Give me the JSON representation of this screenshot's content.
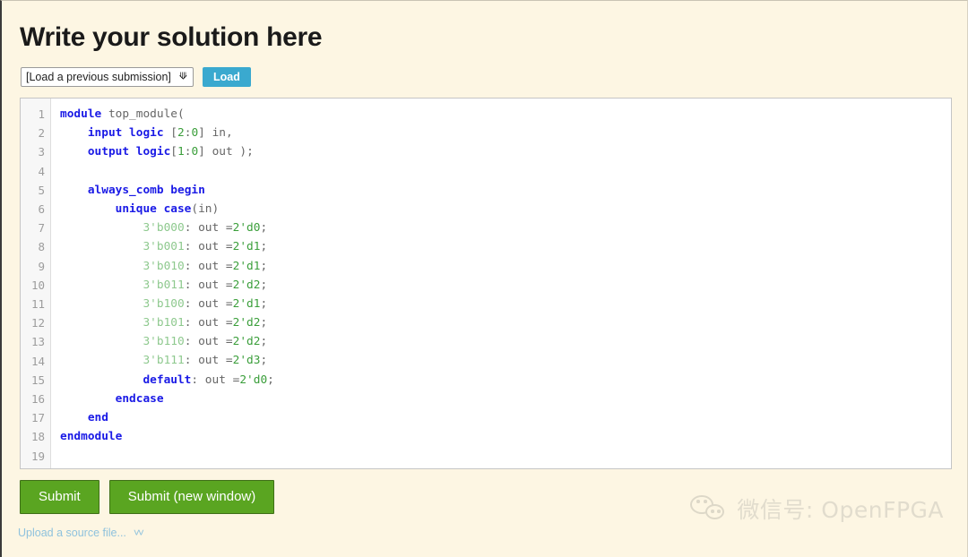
{
  "page": {
    "title": "Write your solution here",
    "background_color": "#fdf6e3"
  },
  "toolbar": {
    "submission_select": {
      "selected": "[Load a previous submission]",
      "options": [
        "[Load a previous submission]"
      ],
      "arrow_icon": "chevron-down-icon"
    },
    "load_label": "Load",
    "load_color": "#3aa9cf"
  },
  "editor": {
    "language": "systemverilog",
    "line_numbers": [
      "1",
      "2",
      "3",
      "4",
      "5",
      "6",
      "7",
      "8",
      "9",
      "10",
      "11",
      "12",
      "13",
      "14",
      "15",
      "16",
      "17",
      "18",
      "19"
    ],
    "lines": [
      {
        "n": "1",
        "tokens": [
          {
            "t": "module",
            "c": "k"
          },
          {
            "t": " top_module(",
            "c": "p"
          }
        ]
      },
      {
        "n": "2",
        "tokens": [
          {
            "t": "    ",
            "c": "p"
          },
          {
            "t": "input logic",
            "c": "k"
          },
          {
            "t": " [",
            "c": "p"
          },
          {
            "t": "2",
            "c": "n"
          },
          {
            "t": ":",
            "c": "p"
          },
          {
            "t": "0",
            "c": "n"
          },
          {
            "t": "] in,",
            "c": "p"
          }
        ]
      },
      {
        "n": "3",
        "tokens": [
          {
            "t": "    ",
            "c": "p"
          },
          {
            "t": "output logic",
            "c": "k"
          },
          {
            "t": "[",
            "c": "p"
          },
          {
            "t": "1",
            "c": "n"
          },
          {
            "t": ":",
            "c": "p"
          },
          {
            "t": "0",
            "c": "n"
          },
          {
            "t": "] out );",
            "c": "p"
          }
        ]
      },
      {
        "n": "4",
        "tokens": [
          {
            "t": "",
            "c": "p"
          }
        ]
      },
      {
        "n": "5",
        "tokens": [
          {
            "t": "    ",
            "c": "p"
          },
          {
            "t": "always_comb begin",
            "c": "k"
          }
        ]
      },
      {
        "n": "6",
        "tokens": [
          {
            "t": "        ",
            "c": "p"
          },
          {
            "t": "unique case",
            "c": "k"
          },
          {
            "t": "(in)",
            "c": "p"
          }
        ]
      },
      {
        "n": "7",
        "tokens": [
          {
            "t": "            ",
            "c": "p"
          },
          {
            "t": "3'b000",
            "c": "nl"
          },
          {
            "t": ": out =",
            "c": "p"
          },
          {
            "t": "2",
            "c": "n"
          },
          {
            "t": "'d0",
            "c": "n"
          },
          {
            "t": ";",
            "c": "p"
          }
        ]
      },
      {
        "n": "8",
        "tokens": [
          {
            "t": "            ",
            "c": "p"
          },
          {
            "t": "3'b001",
            "c": "nl"
          },
          {
            "t": ": out =",
            "c": "p"
          },
          {
            "t": "2",
            "c": "n"
          },
          {
            "t": "'d1",
            "c": "n"
          },
          {
            "t": ";",
            "c": "p"
          }
        ]
      },
      {
        "n": "9",
        "tokens": [
          {
            "t": "            ",
            "c": "p"
          },
          {
            "t": "3'b010",
            "c": "nl"
          },
          {
            "t": ": out =",
            "c": "p"
          },
          {
            "t": "2",
            "c": "n"
          },
          {
            "t": "'d1",
            "c": "n"
          },
          {
            "t": ";",
            "c": "p"
          }
        ]
      },
      {
        "n": "10",
        "tokens": [
          {
            "t": "            ",
            "c": "p"
          },
          {
            "t": "3'b011",
            "c": "nl"
          },
          {
            "t": ": out =",
            "c": "p"
          },
          {
            "t": "2",
            "c": "n"
          },
          {
            "t": "'d2",
            "c": "n"
          },
          {
            "t": ";",
            "c": "p"
          }
        ]
      },
      {
        "n": "11",
        "tokens": [
          {
            "t": "            ",
            "c": "p"
          },
          {
            "t": "3'b100",
            "c": "nl"
          },
          {
            "t": ": out =",
            "c": "p"
          },
          {
            "t": "2",
            "c": "n"
          },
          {
            "t": "'d1",
            "c": "n"
          },
          {
            "t": ";",
            "c": "p"
          }
        ]
      },
      {
        "n": "12",
        "tokens": [
          {
            "t": "            ",
            "c": "p"
          },
          {
            "t": "3'b101",
            "c": "nl"
          },
          {
            "t": ": out =",
            "c": "p"
          },
          {
            "t": "2",
            "c": "n"
          },
          {
            "t": "'d2",
            "c": "n"
          },
          {
            "t": ";",
            "c": "p"
          }
        ]
      },
      {
        "n": "13",
        "tokens": [
          {
            "t": "            ",
            "c": "p"
          },
          {
            "t": "3'b110",
            "c": "nl"
          },
          {
            "t": ": out =",
            "c": "p"
          },
          {
            "t": "2",
            "c": "n"
          },
          {
            "t": "'d2",
            "c": "n"
          },
          {
            "t": ";",
            "c": "p"
          }
        ]
      },
      {
        "n": "14",
        "tokens": [
          {
            "t": "            ",
            "c": "p"
          },
          {
            "t": "3'b111",
            "c": "nl"
          },
          {
            "t": ": out =",
            "c": "p"
          },
          {
            "t": "2",
            "c": "n"
          },
          {
            "t": "'d3",
            "c": "n"
          },
          {
            "t": ";",
            "c": "p"
          }
        ]
      },
      {
        "n": "15",
        "tokens": [
          {
            "t": "            ",
            "c": "p"
          },
          {
            "t": "default",
            "c": "k"
          },
          {
            "t": ": out =",
            "c": "p"
          },
          {
            "t": "2",
            "c": "n"
          },
          {
            "t": "'d0",
            "c": "n"
          },
          {
            "t": ";",
            "c": "p"
          }
        ]
      },
      {
        "n": "16",
        "tokens": [
          {
            "t": "        ",
            "c": "p"
          },
          {
            "t": "endcase",
            "c": "k"
          }
        ]
      },
      {
        "n": "17",
        "tokens": [
          {
            "t": "    ",
            "c": "p"
          },
          {
            "t": "end",
            "c": "k"
          }
        ]
      },
      {
        "n": "18",
        "tokens": [
          {
            "t": "endmodule",
            "c": "k"
          }
        ]
      },
      {
        "n": "19",
        "tokens": [
          {
            "t": "",
            "c": "p"
          }
        ]
      }
    ],
    "colors": {
      "keyword": "#1a1ae6",
      "number": "#3a9e3a",
      "literal": "#8ec98e",
      "plain": "#666666",
      "background": "#ffffff",
      "gutter": "#f7f7f7"
    }
  },
  "actions": {
    "submit_label": "Submit",
    "submit_new_window_label": "Submit (new window)",
    "submit_color": "#5aa521"
  },
  "upload": {
    "label": "Upload a source file...",
    "expand_icon": "double-chevron-down-icon"
  },
  "watermark": {
    "icon": "wechat-icon",
    "text": "微信号: OpenFPGA"
  }
}
